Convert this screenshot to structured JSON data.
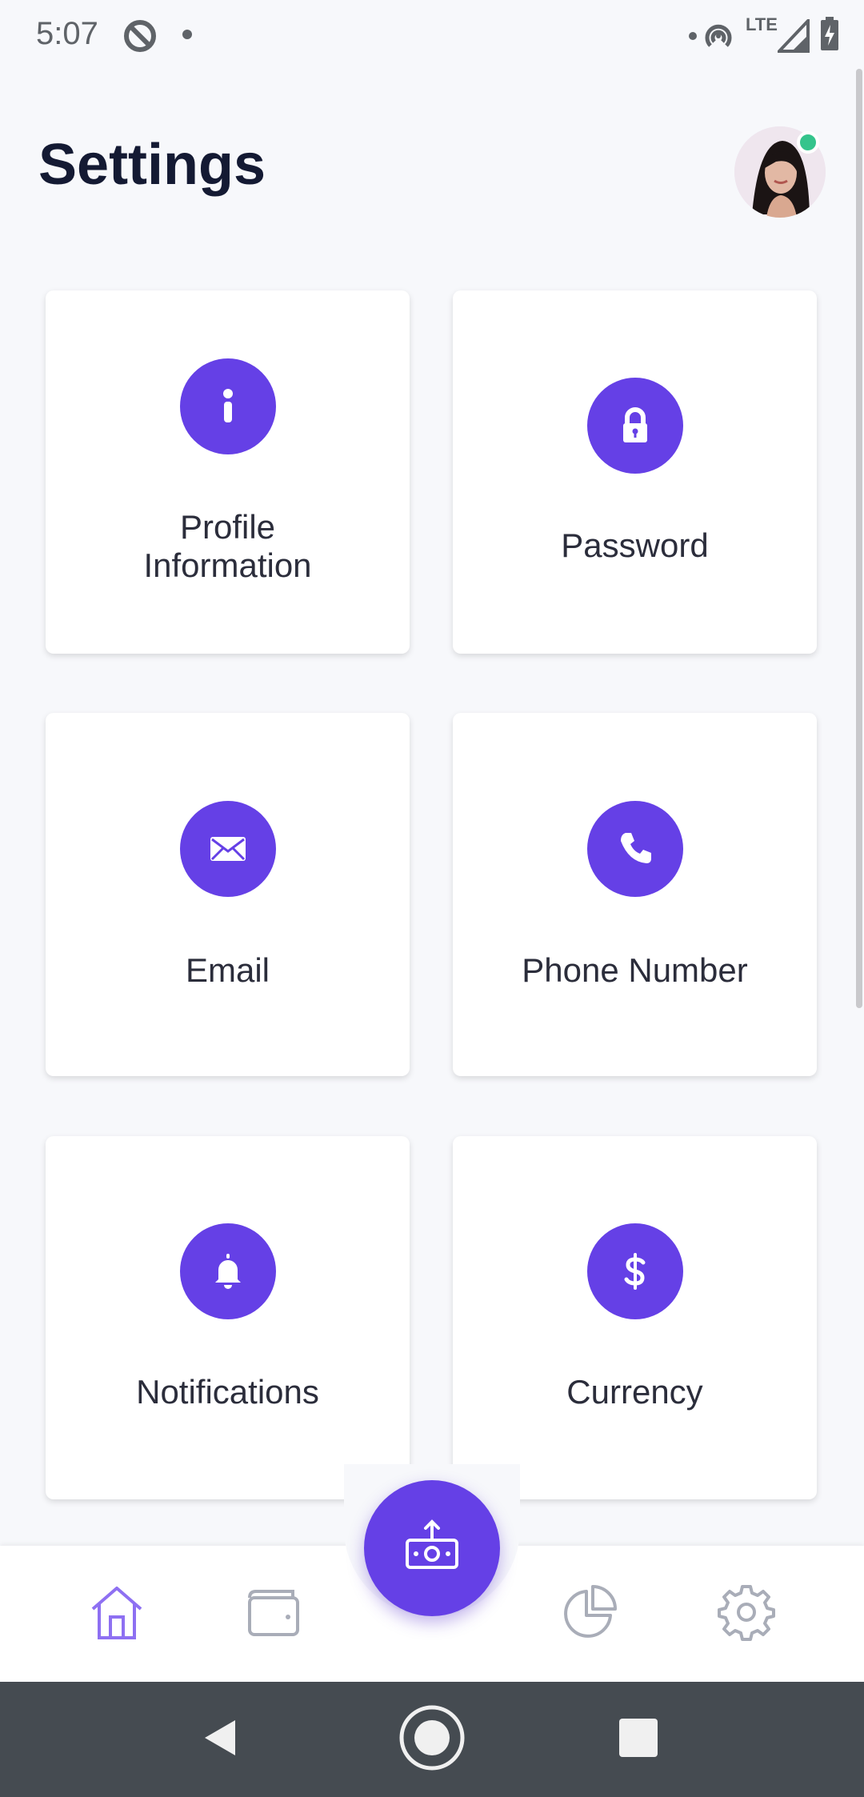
{
  "status_bar": {
    "time": "5:07",
    "network": "LTE"
  },
  "header": {
    "title": "Settings"
  },
  "cards": [
    {
      "label": "Profile\nInformation",
      "icon": "info-icon"
    },
    {
      "label": "Password",
      "icon": "lock-icon"
    },
    {
      "label": "Email",
      "icon": "mail-icon"
    },
    {
      "label": "Phone Number",
      "icon": "phone-icon"
    },
    {
      "label": "Notifications",
      "icon": "bell-icon"
    },
    {
      "label": "Currency",
      "icon": "dollar-icon"
    }
  ],
  "bottom_nav": {
    "items": [
      "home-icon",
      "wallet-icon",
      "pie-chart-icon",
      "gear-icon"
    ],
    "fab_icon": "cash-upload-icon"
  },
  "colors": {
    "accent": "#6540e6",
    "title": "#141a33",
    "online": "#35c48c"
  }
}
